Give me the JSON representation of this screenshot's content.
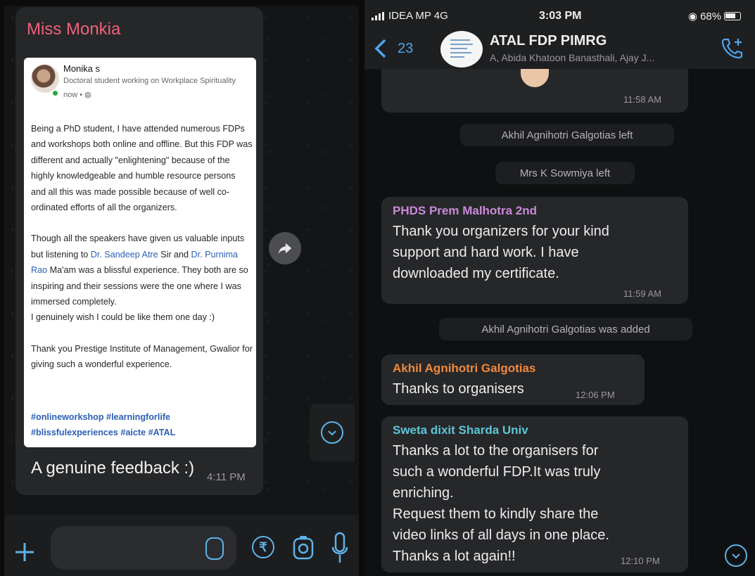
{
  "left": {
    "sender": "Miss Monkia",
    "post": {
      "author": "Monika s",
      "headline": "Doctoral student working on Workplace Spirituality",
      "time": "now • ",
      "p1": "Being a PhD student, I have attended numerous FDPs and workshops both online and offline. But this FDP was different and actually \"enlightening\" because of the highly knowledgeable and humble resource persons and all this was made possible because of well co-ordinated efforts of all the organizers.",
      "p2_a": "Though all the speakers have given us valuable inputs but listening to ",
      "p2_link1": "Dr. Sandeep Atre",
      "p2_b": " Sir and ",
      "p2_link2": "Dr. Purnima Rao",
      "p2_c": " Ma'am was a blissful experience. They both are so inspiring and their sessions were the one where I was immersed completely.",
      "p3": "I genuinely wish I could be like them one day :)",
      "p4": "Thank you Prestige Institute of Management, Gwalior for giving such a wonderful experience.",
      "tags": "#onlineworkshop #learningforlife #blissfulexperiences #aicte #ATAL"
    },
    "caption": "A genuine feedback :)",
    "time": "4:11 PM"
  },
  "status": {
    "carrier": "IDEA MP  4G",
    "clock": "3:03 PM",
    "battery": "68%"
  },
  "header": {
    "back_count": "23",
    "title": "ATAL FDP  PIMRG",
    "members": "A, Abida Khatoon Banasthali, Ajay J..."
  },
  "messages": {
    "m0_time": "11:58 AM",
    "sys1": "Akhil Agnihotri Galgotias left",
    "sys2": "Mrs K Sowmiya left",
    "m1": {
      "sender": "PHDS Prem Malhotra 2nd",
      "lines": [
        "Thank you organizers for your kind",
        "support and hard work. I have",
        "downloaded my certificate."
      ],
      "time": "11:59 AM",
      "color": "#c98ad8"
    },
    "sys3": "Akhil Agnihotri Galgotias was added",
    "m2": {
      "sender": "Akhil Agnihotri Galgotias",
      "text": "Thanks to organisers",
      "time": "12:06 PM",
      "color": "#f08a3c"
    },
    "m3": {
      "sender": "Sweta dixit Sharda Univ",
      "lines": [
        "Thanks a lot to the organisers  for",
        "such a wonderful FDP.It was truly",
        "enriching.",
        "Request them to kindly share the",
        "video links of all days in one place.",
        "Thanks a lot again!!"
      ],
      "time": "12:10 PM",
      "color": "#5cc6d8"
    }
  }
}
